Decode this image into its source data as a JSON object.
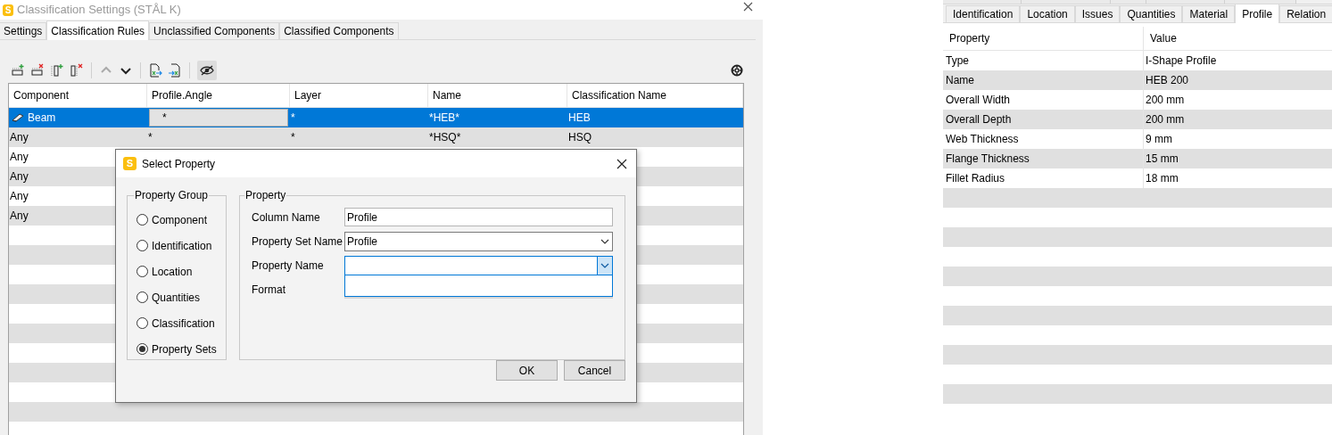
{
  "main_window": {
    "logo": "S",
    "title": "Classification Settings (STÅL K)",
    "tabs": [
      {
        "label": "Settings",
        "selected": false
      },
      {
        "label": "Classification Rules",
        "selected": true
      },
      {
        "label": "Unclassified Components",
        "selected": false
      },
      {
        "label": "Classified Components",
        "selected": false
      }
    ],
    "grid": {
      "columns": [
        "Component",
        "Profile.Angle",
        "Layer",
        "Name",
        "Classification Name"
      ],
      "rows": [
        {
          "kind": "beam",
          "selected": true,
          "cells": [
            "Beam",
            "*",
            "*",
            "*HEB*",
            "HEB"
          ]
        },
        {
          "kind": "any",
          "selected": false,
          "cells": [
            "Any",
            "*",
            "*",
            "*HSQ*",
            "HSQ"
          ]
        },
        {
          "kind": "any",
          "selected": false,
          "cells": [
            "Any"
          ]
        },
        {
          "kind": "any",
          "selected": false,
          "cells": [
            "Any"
          ]
        },
        {
          "kind": "any",
          "selected": false,
          "cells": [
            "Any"
          ]
        },
        {
          "kind": "any",
          "selected": false,
          "cells": [
            "Any"
          ]
        }
      ]
    }
  },
  "select_property_dialog": {
    "logo": "S",
    "title": "Select Property",
    "property_group": {
      "label": "Property Group",
      "options": [
        {
          "label": "Component",
          "selected": false
        },
        {
          "label": "Identification",
          "selected": false
        },
        {
          "label": "Location",
          "selected": false
        },
        {
          "label": "Quantities",
          "selected": false
        },
        {
          "label": "Classification",
          "selected": false
        },
        {
          "label": "Property Sets",
          "selected": true
        }
      ]
    },
    "property": {
      "label": "Property",
      "fields": [
        {
          "label": "Column Name",
          "kind": "text",
          "value": "Profile"
        },
        {
          "label": "Property Set Name",
          "kind": "select",
          "value": "Profile",
          "expanded": false
        },
        {
          "label": "Property Name",
          "kind": "select",
          "expanded": true
        },
        {
          "label": "Format",
          "kind": "covered"
        }
      ]
    },
    "buttons": [
      "OK",
      "Cancel"
    ]
  },
  "properties_panel": {
    "tabs": [
      {
        "label": "Identification",
        "selected": false
      },
      {
        "label": "Location",
        "selected": false
      },
      {
        "label": "Issues",
        "selected": false
      },
      {
        "label": "Quantities",
        "selected": false
      },
      {
        "label": "Material",
        "selected": false
      },
      {
        "label": "Profile",
        "selected": true
      },
      {
        "label": "Relation",
        "selected": false
      }
    ],
    "columns": [
      "Property",
      "Value"
    ],
    "rows": [
      {
        "property": "Type",
        "value": "I-Shape Profile"
      },
      {
        "property": "Name",
        "value": "HEB 200"
      },
      {
        "property": "Overall Width",
        "value": "200 mm"
      },
      {
        "property": "Overall Depth",
        "value": "200 mm"
      },
      {
        "property": "Web Thickness",
        "value": "9 mm"
      },
      {
        "property": "Flange Thickness",
        "value": "15 mm"
      },
      {
        "property": "Fillet Radius",
        "value": "18 mm"
      }
    ]
  }
}
